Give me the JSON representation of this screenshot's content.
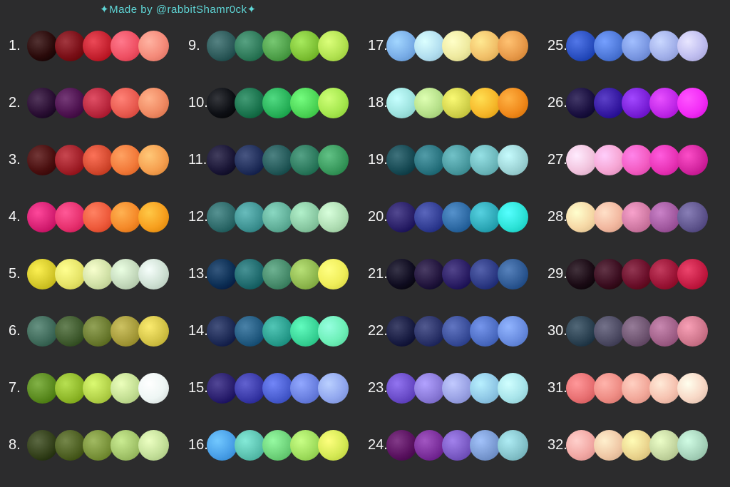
{
  "credit": "✦Made by @rabbitShamr0ck✦",
  "palettes": [
    {
      "n": "1.",
      "colors": [
        "#2a0a0a",
        "#7a0f17",
        "#c4212f",
        "#ef5164",
        "#f58b7a"
      ]
    },
    {
      "n": "2.",
      "colors": [
        "#2a0e33",
        "#4d124f",
        "#b8273d",
        "#e85a4f",
        "#f08a63"
      ]
    },
    {
      "n": "3.",
      "colors": [
        "#4a0f0f",
        "#a01f28",
        "#d44a30",
        "#f27a3a",
        "#f6a050"
      ]
    },
    {
      "n": "4.",
      "colors": [
        "#d62073",
        "#e7316f",
        "#ee5a3b",
        "#f58a2a",
        "#f7a01f"
      ]
    },
    {
      "n": "5.",
      "colors": [
        "#d4c82a",
        "#e6e468",
        "#d0e0a6",
        "#c3d8bb",
        "#cfe1d4"
      ]
    },
    {
      "n": "6.",
      "colors": [
        "#3f6a5a",
        "#3f5a2e",
        "#6a7a2f",
        "#a59a3a",
        "#d4c448"
      ]
    },
    {
      "n": "7.",
      "colors": [
        "#5a8a1f",
        "#8fb82a",
        "#b3d24a",
        "#c4df94",
        "#eef6f4"
      ]
    },
    {
      "n": "8.",
      "colors": [
        "#33401a",
        "#4d5f22",
        "#79923a",
        "#a2c46a",
        "#c4e09a"
      ]
    },
    {
      "n": "9.",
      "colors": [
        "#2d5a5a",
        "#2f7a5a",
        "#4fa04a",
        "#7fc236",
        "#b3e352"
      ]
    },
    {
      "n": "10.",
      "colors": [
        "#0d0f14",
        "#1a734d",
        "#29b25a",
        "#4dd557",
        "#a6e84f"
      ]
    },
    {
      "n": "11.",
      "colors": [
        "#1a1636",
        "#202e5a",
        "#255a5a",
        "#2d7a5e",
        "#3a9a5e"
      ]
    },
    {
      "n": "12.",
      "colors": [
        "#2e6a6a",
        "#409494",
        "#62b09a",
        "#8ac9a3",
        "#b0deb4"
      ]
    },
    {
      "n": "13.",
      "colors": [
        "#0c2f55",
        "#1f6a6d",
        "#468a6a",
        "#8fb84f",
        "#f0ee5a"
      ]
    },
    {
      "n": "14.",
      "colors": [
        "#1d2a55",
        "#225a80",
        "#2a9e8e",
        "#3ad497",
        "#6ef0b8"
      ]
    },
    {
      "n": "15.",
      "colors": [
        "#2a1f6e",
        "#3a3aa8",
        "#4a5ed0",
        "#6a80e0",
        "#92a8ef"
      ]
    },
    {
      "n": "16.",
      "colors": [
        "#4aa0e8",
        "#5cc2b0",
        "#6ed27a",
        "#a0de5e",
        "#d6ea56"
      ]
    },
    {
      "n": "17.",
      "colors": [
        "#7aaee8",
        "#b3dff0",
        "#efeaa0",
        "#f2c16a",
        "#e89a4a"
      ]
    },
    {
      "n": "18.",
      "colors": [
        "#9ee3df",
        "#b6e08a",
        "#d2d24c",
        "#f6b72a",
        "#f08a1c"
      ]
    },
    {
      "n": "19.",
      "colors": [
        "#174a54",
        "#2a7480",
        "#4a9aa0",
        "#6eb9bd",
        "#9ed4d6"
      ]
    },
    {
      "n": "20.",
      "colors": [
        "#2a2068",
        "#323e94",
        "#2e6aa4",
        "#2ea9b8",
        "#2ee3d8"
      ]
    },
    {
      "n": "21.",
      "colors": [
        "#0f0c20",
        "#22153d",
        "#2a1d63",
        "#2d3a84",
        "#2f5a94"
      ]
    },
    {
      "n": "22.",
      "colors": [
        "#181c42",
        "#2a3268",
        "#3a4e9a",
        "#4e6ec4",
        "#6a8de0"
      ]
    },
    {
      "n": "23.",
      "colors": [
        "#6a4cc8",
        "#8a7ad8",
        "#9aa2e4",
        "#90c8e6",
        "#a8e4ea"
      ]
    },
    {
      "n": "24.",
      "colors": [
        "#5a1260",
        "#7a2e9a",
        "#7a5ac4",
        "#7a9ad2",
        "#86c4cc"
      ]
    },
    {
      "n": "25.",
      "colors": [
        "#2a4fc0",
        "#4e78d8",
        "#7a97e2",
        "#a2b0ea",
        "#c0bef0"
      ]
    },
    {
      "n": "26.",
      "colors": [
        "#1a1040",
        "#3418a0",
        "#7a20d8",
        "#c028e8",
        "#f22cf6"
      ]
    },
    {
      "n": "27.",
      "colors": [
        "#f2c4de",
        "#f6a6d4",
        "#f35cc2",
        "#e834b6",
        "#d426a0"
      ]
    },
    {
      "n": "28.",
      "colors": [
        "#f6d8a6",
        "#f2b8a0",
        "#d07aa4",
        "#a25aa0",
        "#60568e"
      ]
    },
    {
      "n": "29.",
      "colors": [
        "#1a0a14",
        "#3a0d1f",
        "#6a0f2a",
        "#9a1436",
        "#c41c44"
      ]
    },
    {
      "n": "30.",
      "colors": [
        "#2a4050",
        "#4c4a62",
        "#6e5470",
        "#a06088",
        "#d0788e"
      ]
    },
    {
      "n": "31.",
      "colors": [
        "#e87072",
        "#ee8c84",
        "#f2a89a",
        "#f6c2b0",
        "#f8d8c6"
      ]
    },
    {
      "n": "32.",
      "colors": [
        "#f2a8a4",
        "#f0c8a6",
        "#ead48e",
        "#c4d6a0",
        "#a8d4bc"
      ]
    }
  ]
}
